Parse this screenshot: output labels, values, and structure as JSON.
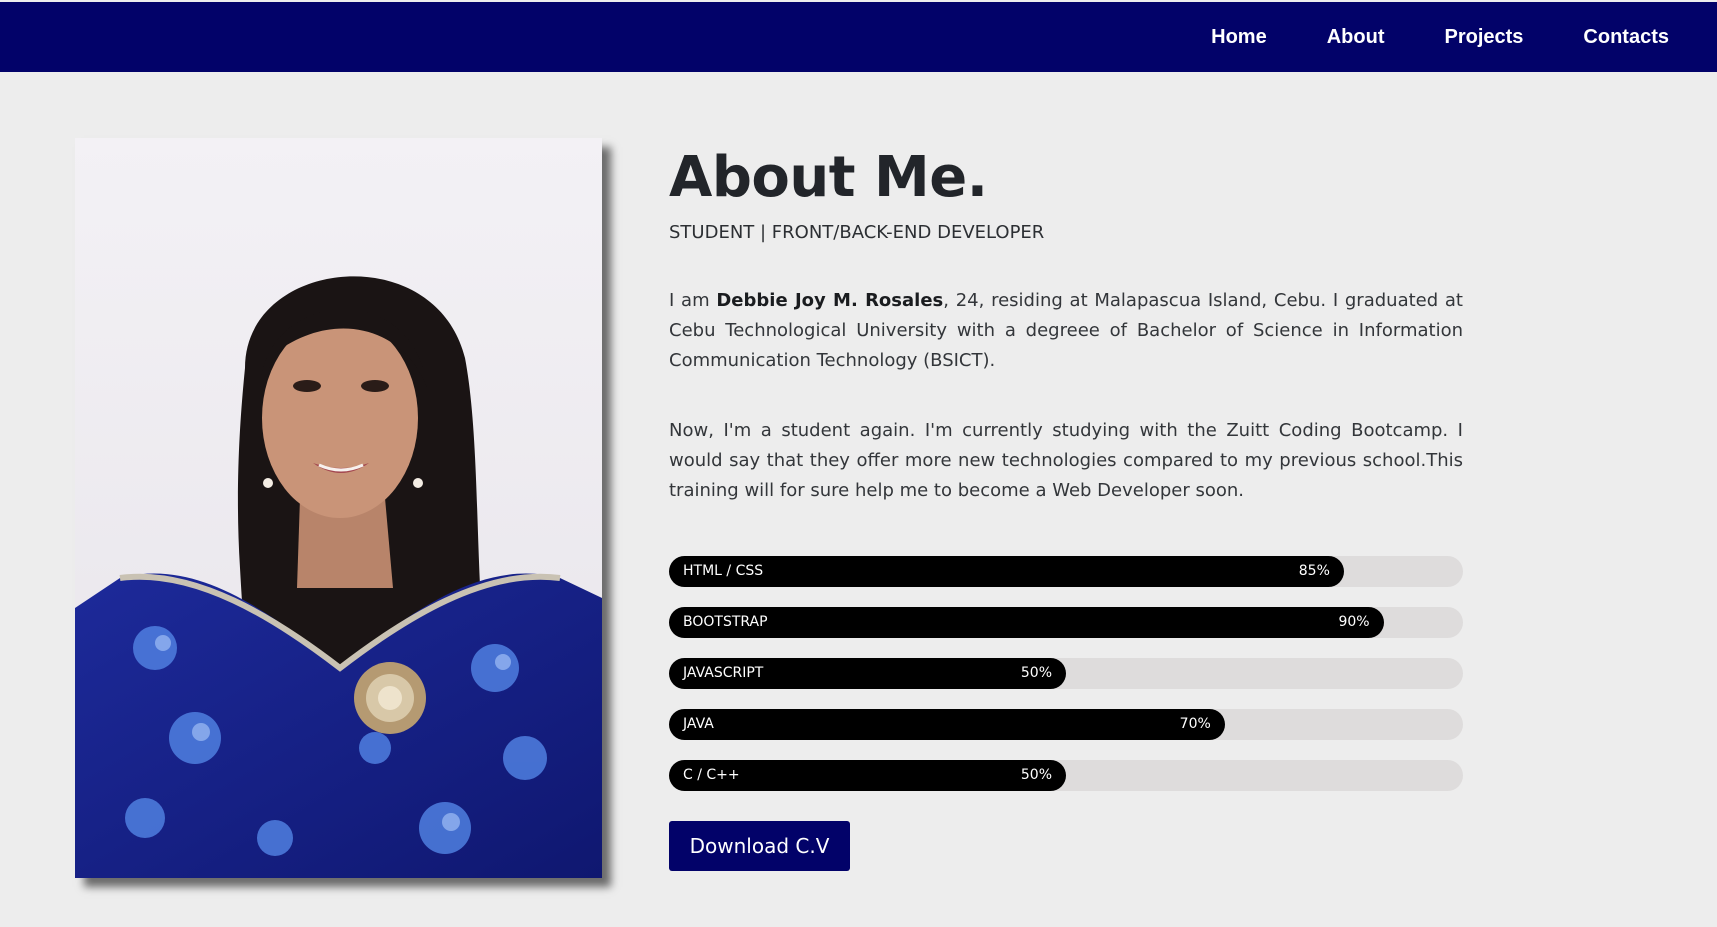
{
  "nav": {
    "items": [
      {
        "label": "Home"
      },
      {
        "label": "About"
      },
      {
        "label": "Projects"
      },
      {
        "label": "Contacts"
      }
    ]
  },
  "about": {
    "title": "About Me.",
    "subtitle": "STUDENT | FRONT/BACK-END DEVELOPER",
    "para1_prefix": "I am ",
    "name": "Debbie Joy M. Rosales",
    "para1_suffix": ", 24, residing at Malapascua Island, Cebu. I graduated at Cebu Technological University with a degreee of Bachelor of Science in Information Communication Technology (BSICT).",
    "para2": "Now, I'm a student again. I'm currently studying with the Zuitt Coding Bootcamp. I would say that they offer more new technologies compared to my previous school.This training will for sure help me to become a Web Developer soon."
  },
  "skills": [
    {
      "name": "HTML / CSS",
      "percent_label": "85%",
      "value": 85
    },
    {
      "name": "BOOTSTRAP",
      "percent_label": "90%",
      "value": 90
    },
    {
      "name": "JAVASCRIPT",
      "percent_label": "50%",
      "value": 50
    },
    {
      "name": "JAVA",
      "percent_label": "70%",
      "value": 70
    },
    {
      "name": "C / C++",
      "percent_label": "50%",
      "value": 50
    }
  ],
  "download_label": "Download C.V",
  "colors": {
    "nav_bg": "#020269",
    "page_bg": "#ededed",
    "bar_track": "#dedcdc",
    "bar_fill": "#000000",
    "button_bg": "#020269"
  }
}
